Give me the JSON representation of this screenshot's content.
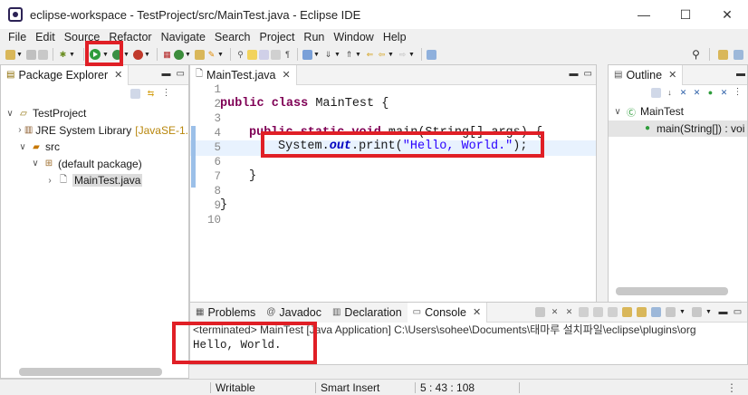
{
  "window": {
    "title": "eclipse-workspace - TestProject/src/MainTest.java - Eclipse IDE",
    "controls": [
      "—",
      "☐",
      "✕"
    ]
  },
  "menu": [
    "File",
    "Edit",
    "Source",
    "Refactor",
    "Navigate",
    "Search",
    "Project",
    "Run",
    "Window",
    "Help"
  ],
  "package_explorer": {
    "tab_label": "Package Explorer",
    "tree": [
      {
        "label": "TestProject",
        "level": 0,
        "expanded": true
      },
      {
        "label": "JRE System Library",
        "decor": "[JavaSE-1.",
        "level": 1,
        "expanded": false
      },
      {
        "label": "src",
        "level": 1,
        "expanded": true
      },
      {
        "label": "(default package)",
        "level": 2,
        "expanded": true
      },
      {
        "label": "MainTest.java",
        "level": 3,
        "expanded": false
      }
    ]
  },
  "editor": {
    "tab_label": "MainTest.java",
    "line_numbers": [
      "1",
      "2",
      "3",
      "4",
      "5",
      "6",
      "7",
      "8",
      "9",
      "10"
    ],
    "lines": {
      "l2_kw": "public class",
      "l2_rest": " MainTest {",
      "l4_kw": "public static void",
      "l4_rest": " main(String[] args) {",
      "l5_a": "System.",
      "l5_field": "out",
      "l5_b": ".print(",
      "l5_str": "\"Hello, World.\"",
      "l5_c": ");",
      "l7": "}",
      "l9": "}"
    }
  },
  "outline": {
    "tab_label": "Outline",
    "items": [
      "MainTest",
      "main(String[]) : voi"
    ]
  },
  "bottom_tabs": {
    "problems": "Problems",
    "javadoc": "Javadoc",
    "declaration": "Declaration",
    "console": "Console"
  },
  "console": {
    "status": "<terminated> MainTest [Java Application] C:\\Users\\sohee\\Documents\\태마루 설치파일\\eclipse\\plugins\\org",
    "output": "Hello, World."
  },
  "statusbar": {
    "mode": "Writable",
    "insert": "Smart Insert",
    "position": "5 : 43 : 108"
  },
  "colors": {
    "highlight": "#e01f26",
    "keyword": "#7f0055",
    "string": "#2a00ff",
    "run": "#2e9c3b"
  }
}
